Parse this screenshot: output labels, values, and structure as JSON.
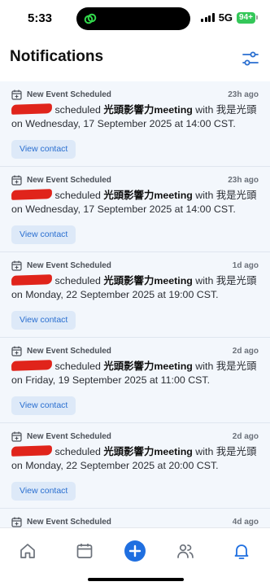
{
  "status_bar": {
    "time": "5:33",
    "network": "5G",
    "battery": "94+",
    "island_icon": "link-icon"
  },
  "header": {
    "title": "Notifications",
    "filter_icon": "sliders-icon"
  },
  "notifications": [
    {
      "event_title": "New Event Scheduled",
      "age": "23h ago",
      "pre": "scheduled ",
      "meeting": "光頭影響力meeting",
      "post": " with 我是光頭 on Wednesday, 17 September 2025 at 14:00 CST.",
      "button": "View contact"
    },
    {
      "event_title": "New Event Scheduled",
      "age": "23h ago",
      "pre": "scheduled ",
      "meeting": "光頭影響力meeting",
      "post": " with 我是光頭 on Wednesday, 17 September 2025 at 14:00 CST.",
      "button": "View contact"
    },
    {
      "event_title": "New Event Scheduled",
      "age": "1d ago",
      "pre": "scheduled ",
      "meeting": "光頭影響力meeting",
      "post": " with 我是光頭 on Monday, 22 September 2025 at 19:00 CST.",
      "button": "View contact"
    },
    {
      "event_title": "New Event Scheduled",
      "age": "2d ago",
      "pre": "scheduled ",
      "meeting": "光頭影響力meeting",
      "post": " with 我是光頭 on Friday, 19 September 2025 at 11:00 CST.",
      "button": "View contact"
    },
    {
      "event_title": "New Event Scheduled",
      "age": "2d ago",
      "pre": "scheduled ",
      "meeting": "光頭影響力meeting",
      "post": " with 我是光頭 on Monday, 22 September 2025 at 20:00 CST.",
      "button": "View contact"
    },
    {
      "event_title": "New Event Scheduled",
      "age": "4d ago",
      "pre": "",
      "meeting": "",
      "post": "",
      "button": ""
    }
  ],
  "tabbar": {
    "items": [
      "home-icon",
      "calendar-icon",
      "add-icon",
      "contacts-icon",
      "bell-icon"
    ],
    "active": "bell-icon"
  },
  "colors": {
    "accent": "#1f6fe0",
    "card_bg": "#f3f7fc",
    "button_bg": "#dde9f8",
    "battery": "#34c759",
    "redaction": "#e0241b"
  }
}
